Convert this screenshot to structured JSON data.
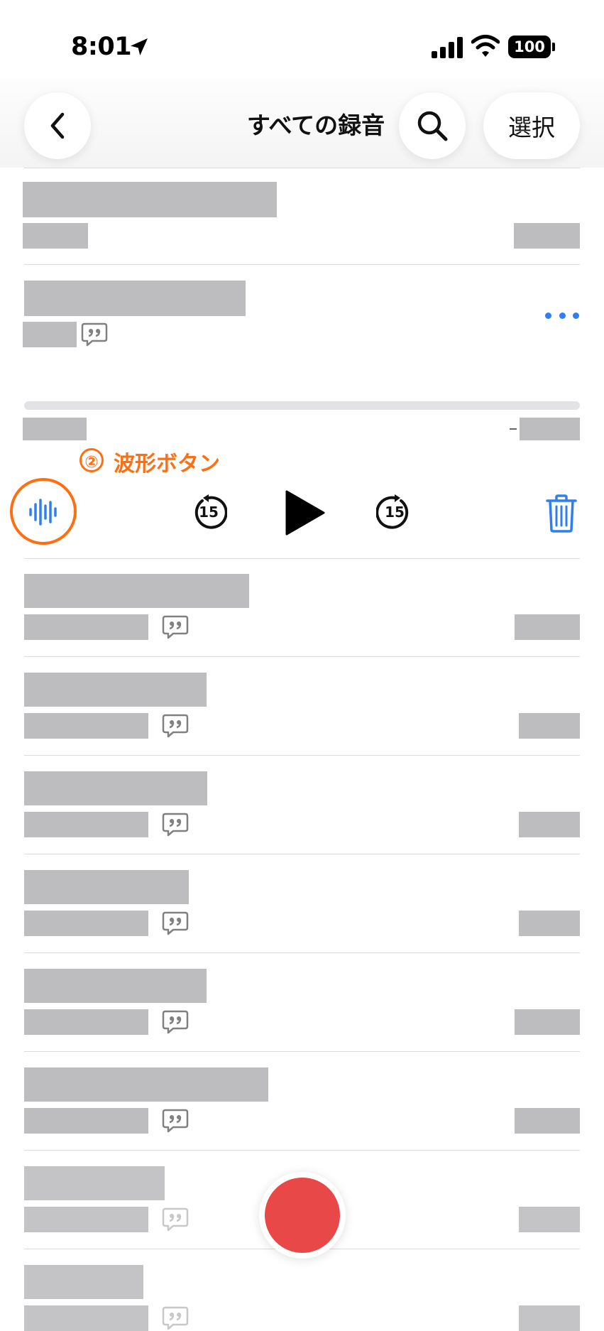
{
  "status_bar": {
    "time": "8:01",
    "battery": "100"
  },
  "header": {
    "title": "すべての録音",
    "select_label": "選択"
  },
  "annotation": {
    "number": "②",
    "label": "波形ボタン"
  },
  "icons": {
    "back": "chevron-left-icon",
    "search": "search-icon",
    "more": "ellipsis-icon",
    "waveform": "waveform-icon",
    "skip_back": "skip-back-15-icon",
    "play": "play-icon",
    "skip_forward": "skip-forward-15-icon",
    "trash": "trash-icon",
    "transcript": "quote-bubble-icon",
    "record": "record-icon"
  },
  "player": {
    "skip_seconds": "15"
  },
  "colors": {
    "accent": "#2f7ff0",
    "record": "#e84848",
    "annotation": "#ff6f12"
  },
  "recordings_count_visible": 10
}
